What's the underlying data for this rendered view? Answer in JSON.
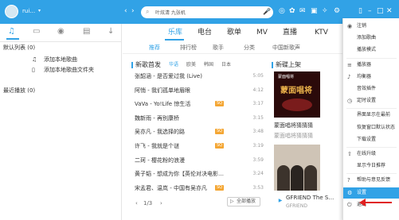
{
  "titlebar": {
    "username": "rui…",
    "search_placeholder": "叶炫清 九张机",
    "nav_back": "‹",
    "nav_forward": "›",
    "refresh": "↻",
    "user_dropdown": "▾",
    "colors": {
      "bg": "#31a2e6"
    }
  },
  "sidebar": {
    "icons": [
      "music-note-icon",
      "monitor-icon",
      "radio-icon",
      "folder-icon",
      "download-icon"
    ],
    "default_list": "默认列表 (0)",
    "add_local_song": "添加本地歌曲",
    "add_local_folder": "添加本地歌曲文件夹",
    "recent_play": "最近播放 (0)"
  },
  "tabs_main": [
    "乐库",
    "电台",
    "歌单",
    "MV",
    "直播",
    "KTV"
  ],
  "tabs_sub": [
    "推荐",
    "排行榜",
    "歌手",
    "分类",
    "中国新歌声"
  ],
  "new_songs": {
    "title": "新歌首发",
    "filters": [
      "华语",
      "欧美",
      "韩国",
      "日本"
    ],
    "songs": [
      {
        "title": "张韶涵 - 是否爱过我 (Live)",
        "duration": "5:05",
        "tag": ""
      },
      {
        "title": "阿悄 - 我们孤单地眉眼",
        "duration": "4:12",
        "tag": ""
      },
      {
        "title": "VaVa - Yo!Life 惊生活",
        "duration": "3:17",
        "tag": "SQ"
      },
      {
        "title": "魏新雨 - 再别康桥",
        "duration": "3:15",
        "tag": ""
      },
      {
        "title": "吴亦凡 - 我选择的路",
        "duration": "3:48",
        "tag": "SQ"
      },
      {
        "title": "许飞 - 我就是个谜",
        "duration": "3:19",
        "tag": "SQ"
      },
      {
        "title": "二珂 - 樱花粉的浪漫",
        "duration": "3:59",
        "tag": ""
      },
      {
        "title": "黄子韬 - 想成为你【英伦对决电影…",
        "duration": "3:24",
        "tag": ""
      },
      {
        "title": "宋孟君、温岚 - 中国有吴亦凡",
        "duration": "3:53",
        "tag": "SQ"
      }
    ],
    "pager": "1/3",
    "pager_prev": "‹",
    "pager_next": "›",
    "play_all": "全部播放"
  },
  "new_albums": {
    "title": "新碟上架",
    "albums": [
      {
        "badge": "蒙面唱将",
        "art_text": "蒙面唱将",
        "title": "蒙面唱将猜猜猜"
      },
      {
        "badge": "",
        "art_text": "",
        "title": "GFRIEND The S…",
        "artist": "GFRIEND"
      }
    ],
    "second_title_top": "蒙面唱将猜猜猜"
  },
  "menu": {
    "items": [
      {
        "icon": "user-icon",
        "glyph": "◉",
        "label": "注销"
      },
      {
        "icon": "",
        "glyph": "",
        "label": "添加歌曲"
      },
      {
        "icon": "",
        "glyph": "",
        "label": "播放模式"
      },
      {
        "icon": "equalizer-icon",
        "glyph": "≡",
        "label": "播放器"
      },
      {
        "icon": "lyric-icon",
        "glyph": "♪",
        "label": "均衡器"
      },
      {
        "icon": "",
        "glyph": "",
        "label": "音效插件"
      },
      {
        "icon": "clock-icon",
        "glyph": "◷",
        "label": "定时设置"
      },
      {
        "icon": "",
        "glyph": "",
        "label": "界面显示在最前"
      },
      {
        "icon": "",
        "glyph": "",
        "label": "恢复窗口默认状态"
      },
      {
        "icon": "",
        "glyph": "",
        "label": "下载设置"
      },
      {
        "icon": "upgrade-icon",
        "glyph": "⇧",
        "label": "在线升级"
      },
      {
        "icon": "",
        "glyph": "",
        "label": "显示今日推荐"
      },
      {
        "icon": "help-icon",
        "glyph": "?",
        "label": "帮助与意见反馈"
      },
      {
        "icon": "settings-icon",
        "glyph": "⚙",
        "label": "设置"
      },
      {
        "icon": "exit-icon",
        "glyph": "⏻",
        "label": "退出"
      }
    ]
  }
}
